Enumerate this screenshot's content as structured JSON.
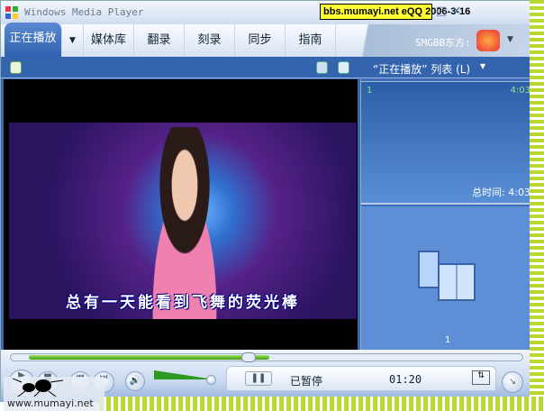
{
  "title": "Windows Media Player",
  "banner": "bbs.mumayi.net  eQQ  2006-3-16",
  "tabs": [
    {
      "label": "正在播放",
      "active": true
    },
    {
      "label": "媒体库"
    },
    {
      "label": "翻录"
    },
    {
      "label": "刻录"
    },
    {
      "label": "同步"
    },
    {
      "label": "指南"
    }
  ],
  "skin_label": "SMGBB东方:",
  "playlist": {
    "title": "“正在播放” 列表 (L)",
    "items": [
      {
        "index": "1",
        "duration": "4:03"
      }
    ],
    "total": "总时间: 4:03",
    "art_count": "1"
  },
  "video": {
    "subtitle": "总有一天能看到飞舞的荧光棒"
  },
  "controls": {
    "status": "已暂停",
    "time": "01:20",
    "seek_progress": 0.47,
    "volume": 0.85
  },
  "watermark": "www.mumayi.net"
}
